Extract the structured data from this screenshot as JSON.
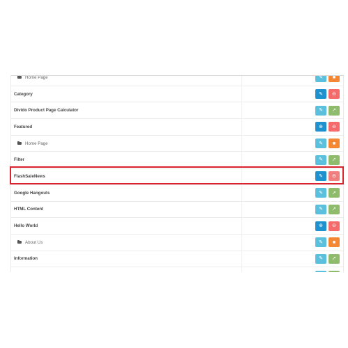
{
  "modules": [
    {
      "name": "Home Page",
      "child": true,
      "actions": [
        {
          "icon": "edit-icon",
          "glyph": "✎",
          "color": "#5bc0de",
          "label": "edit"
        },
        {
          "icon": "delete-icon",
          "glyph": "■",
          "color": "#f38733",
          "label": "delete"
        }
      ]
    },
    {
      "name": "Category",
      "child": false,
      "actions": [
        {
          "icon": "edit-icon",
          "glyph": "✎",
          "color": "#1e91cf",
          "label": "edit"
        },
        {
          "icon": "uninstall-icon",
          "glyph": "⊖",
          "color": "#f56b6b",
          "label": "uninstall"
        }
      ]
    },
    {
      "name": "Divido Product Page Calculator",
      "child": false,
      "actions": [
        {
          "icon": "edit-icon",
          "glyph": "✎",
          "color": "#5bc0de",
          "label": "edit"
        },
        {
          "icon": "install-icon",
          "glyph": "➚",
          "color": "#8fbb6c",
          "label": "install"
        }
      ]
    },
    {
      "name": "Featured",
      "child": false,
      "actions": [
        {
          "icon": "add-icon",
          "glyph": "⊕",
          "color": "#1e91cf",
          "label": "add"
        },
        {
          "icon": "uninstall-icon",
          "glyph": "⊖",
          "color": "#f56b6b",
          "label": "uninstall"
        }
      ]
    },
    {
      "name": "Home Page",
      "child": true,
      "actions": [
        {
          "icon": "edit-icon",
          "glyph": "✎",
          "color": "#5bc0de",
          "label": "edit"
        },
        {
          "icon": "delete-icon",
          "glyph": "■",
          "color": "#f38733",
          "label": "delete"
        }
      ]
    },
    {
      "name": "Filter",
      "child": false,
      "actions": [
        {
          "icon": "edit-icon",
          "glyph": "✎",
          "color": "#5bc0de",
          "label": "edit"
        },
        {
          "icon": "install-icon",
          "glyph": "➚",
          "color": "#8fbb6c",
          "label": "install"
        }
      ]
    },
    {
      "name": "FlashSaleNews",
      "child": false,
      "highlighted": true,
      "actions": [
        {
          "icon": "edit-icon",
          "glyph": "✎",
          "color": "#1e91cf",
          "label": "edit"
        },
        {
          "icon": "uninstall-icon",
          "glyph": "⊖",
          "color": "#f07f7f",
          "label": "uninstall"
        }
      ]
    },
    {
      "name": "Google Hangouts",
      "child": false,
      "actions": [
        {
          "icon": "edit-icon",
          "glyph": "✎",
          "color": "#5bc0de",
          "label": "edit"
        },
        {
          "icon": "install-icon",
          "glyph": "➚",
          "color": "#8fbb6c",
          "label": "install"
        }
      ]
    },
    {
      "name": "HTML Content",
      "child": false,
      "actions": [
        {
          "icon": "edit-icon",
          "glyph": "✎",
          "color": "#5bc0de",
          "label": "edit"
        },
        {
          "icon": "install-icon",
          "glyph": "➚",
          "color": "#8fbb6c",
          "label": "install"
        }
      ]
    },
    {
      "name": "Hello World",
      "child": false,
      "actions": [
        {
          "icon": "add-icon",
          "glyph": "⊕",
          "color": "#1e91cf",
          "label": "add"
        },
        {
          "icon": "uninstall-icon",
          "glyph": "⊖",
          "color": "#f56b6b",
          "label": "uninstall"
        }
      ]
    },
    {
      "name": "About Us",
      "child": true,
      "actions": [
        {
          "icon": "edit-icon",
          "glyph": "✎",
          "color": "#5bc0de",
          "label": "edit"
        },
        {
          "icon": "delete-icon",
          "glyph": "■",
          "color": "#f38733",
          "label": "delete"
        }
      ]
    },
    {
      "name": "Information",
      "child": false,
      "actions": [
        {
          "icon": "edit-icon",
          "glyph": "✎",
          "color": "#5bc0de",
          "label": "edit"
        },
        {
          "icon": "install-icon",
          "glyph": "➚",
          "color": "#8fbb6c",
          "label": "install"
        }
      ]
    },
    {
      "name": "",
      "child": false,
      "actions": [
        {
          "icon": "edit-icon",
          "glyph": "✎",
          "color": "#5bc0de",
          "label": "edit"
        },
        {
          "icon": "install-icon",
          "glyph": "➚",
          "color": "#8fbb6c",
          "label": "install"
        }
      ]
    }
  ],
  "highlight_color": "#d9232d"
}
